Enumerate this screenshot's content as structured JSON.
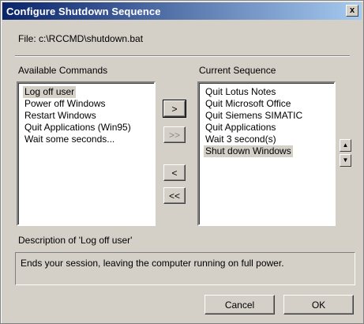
{
  "window": {
    "title": "Configure Shutdown Sequence",
    "close_glyph": "x"
  },
  "file_label": "File: c:\\RCCMD\\shutdown.bat",
  "available": {
    "label": "Available Commands",
    "items": [
      "Log off user",
      "Power off Windows",
      "Restart Windows",
      "Quit Applications (Win95)",
      "Wait some seconds..."
    ],
    "selected_index": 0
  },
  "sequence": {
    "label": "Current Sequence",
    "items": [
      "Quit Lotus Notes",
      "Quit Microsoft Office",
      "Quit Siemens SIMATIC",
      "Quit Applications",
      "Wait 3 second(s)",
      "Shut down Windows"
    ],
    "selected_index": 5
  },
  "transfer_buttons": {
    "add": ">",
    "add_all": ">>",
    "remove": "<",
    "remove_all": "<<"
  },
  "order_buttons": {
    "up_icon": "triangle-up-icon",
    "down_icon": "triangle-down-icon"
  },
  "description": {
    "label": "Description of 'Log off user'",
    "text": "Ends your session, leaving the computer running on full power."
  },
  "footer": {
    "cancel_label": "Cancel",
    "ok_label": "OK"
  }
}
